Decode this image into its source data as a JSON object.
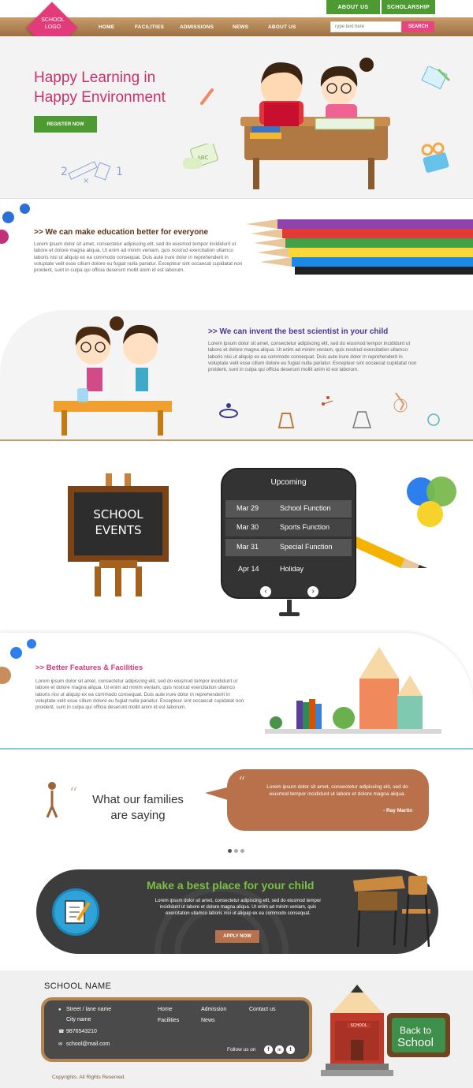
{
  "topnav": {
    "about_btn": "ABOUT US",
    "scholarship_btn": "SCHOLARSHIP"
  },
  "logo": {
    "line1": "SCHOOL",
    "line2": "LOGO"
  },
  "nav": {
    "items": [
      "HOME",
      "FACILITIES",
      "ADMISSIONS",
      "NEWS",
      "ABOUT US"
    ]
  },
  "search": {
    "placeholder": "Type text here",
    "button": "SEARCH"
  },
  "hero": {
    "line1": "Happy Learning in",
    "line2": "Happy Environment",
    "register": "REGISTER NOW"
  },
  "section1": {
    "heading": ">> We can make education better for everyone",
    "body": "Lorem ipsum dolor sit amet, consectetur adipiscing elit, sed do eiusmod tempor incididunt ut labore et dolore magna aliqua. Ut enim ad minim veniam, quis nostrud exercitation ullamco laboris nisi ut aliquip ex ea commodo consequat. Duis aute irure dolor in reprehenderit in voluptate velit esse cillum dolore eu fugiat nulla pariatur. Excepteur sint occaecat cupidatat non proident, sunt in culpa qui officia deserunt mollit anim id est laborum."
  },
  "section2": {
    "heading": ">> We can invent the best scientist in your child",
    "body": "Lorem ipsum dolor sit amet, consectetur adipiscing elit, sed do eiusmod tempor incididunt ut labore et dolore magna aliqua. Ut enim ad minim veniam, quis nostrud exercitation ullamco laboris nisi ut aliquip ex ea commodo consequat. Duis aute irure dolor in reprehenderit in voluptate velit esse cillum dolore eu fugiat nulla pariatur. Excepteur sint occaecat cupidatat non proident, sunt in culpa qui officia deserunt mollit anim id est laborum."
  },
  "events": {
    "board_line1": "SCHOOL",
    "board_line2": "EVENTS",
    "title": "Upcoming",
    "items": [
      {
        "date": "Mar 29",
        "name": "School Function"
      },
      {
        "date": "Mar 30",
        "name": "Sports Function"
      },
      {
        "date": "Mar 31",
        "name": "Special Function"
      },
      {
        "date": "Apr 14",
        "name": "Holiday"
      }
    ],
    "prev": "‹",
    "next": "›"
  },
  "section3": {
    "heading": ">> Better Features & Facilities",
    "body": "Lorem ipsum dolor sit amet, consectetur adipiscing elit, sed do eiusmod tempor incididunt ut labore et dolore magna aliqua. Ut enim ad minim veniam, quis nostrud exercitation ullamco laboris nisi ut aliquip ex ea commodo consequat. Duis aute irure dolor in reprehenderit in voluptate velit esse cillum dolore eu fugiat nulla pariatur. Excepteur sint occaecat cupidatat non proident, sunt in culpa qui officia deserunt mollit anim id est laborum."
  },
  "testimonial": {
    "line1": "What our families",
    "line2": "are saying",
    "quote": "Lorem ipsum dolor sit amet, consectetur adipiscing elit, sed do eiusmod tempor incididunt ut labore et dolore magna aliqua.",
    "author": "- Ray Martin"
  },
  "cta": {
    "title": "Make a best place for your child",
    "body": "Lorem ipsum dolor sit amet, consectetur adipiscing elit, sed do eiusmod tempor incididunt ut labore et dolore magna aliqua. Ut enim ad minim veniam, quis exercitation ullamco laboris nisi ut aliquip ex ea commodo consequat.",
    "button": "APPLY NOW"
  },
  "footer": {
    "school_name": "SCHOOL NAME",
    "street": "Street / lane name",
    "city": "City name",
    "phone": "9876543210",
    "email": "school@mail.com",
    "links": [
      "Home",
      "Facilities",
      "Admission",
      "News",
      "Contact us"
    ],
    "follow": "Follow us on",
    "social": [
      "f",
      "in",
      "t"
    ],
    "copyright": "Copyrights. All Rights Reserved.",
    "board_line1": "Back to",
    "board_line2": "School",
    "pencil_label": "SCHOOL"
  },
  "colors": {
    "green": "#4e9a32",
    "pink": "#e23b7b",
    "brown": "#b5864f",
    "purple": "#5a3e9a"
  }
}
